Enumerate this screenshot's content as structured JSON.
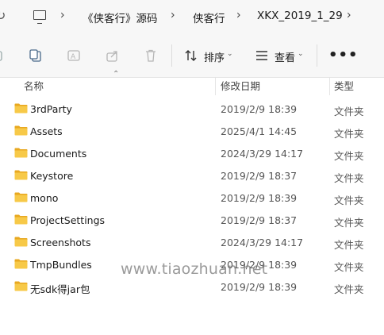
{
  "address": {
    "crumbs": [
      "《侠客行》源码",
      "侠客行",
      "XKX_2019_1_29"
    ]
  },
  "toolbar": {
    "sort_label": "排序",
    "view_label": "查看",
    "more_label": "•••"
  },
  "columns": {
    "name": "名称",
    "modified": "修改日期",
    "type": "类型"
  },
  "files": [
    {
      "name": "3rdParty",
      "modified": "2019/2/9 18:39",
      "type": "文件夹"
    },
    {
      "name": "Assets",
      "modified": "2025/4/1 14:45",
      "type": "文件夹"
    },
    {
      "name": "Documents",
      "modified": "2024/3/29 14:17",
      "type": "文件夹"
    },
    {
      "name": "Keystore",
      "modified": "2019/2/9 18:37",
      "type": "文件夹"
    },
    {
      "name": "mono",
      "modified": "2019/2/9 18:39",
      "type": "文件夹"
    },
    {
      "name": "ProjectSettings",
      "modified": "2019/2/9 18:37",
      "type": "文件夹"
    },
    {
      "name": "Screenshots",
      "modified": "2024/3/29 14:17",
      "type": "文件夹"
    },
    {
      "name": "TmpBundles",
      "modified": "2019/2/9 18:39",
      "type": "文件夹"
    },
    {
      "name": "无sdk得jar包",
      "modified": "2019/2/9 18:39",
      "type": "文件夹"
    }
  ],
  "watermark": "www.tiaozhuan.net",
  "colors": {
    "folder_body": "#F7C948",
    "folder_tab": "#E8A820",
    "toolbar_bg": "#f7f7f7"
  }
}
